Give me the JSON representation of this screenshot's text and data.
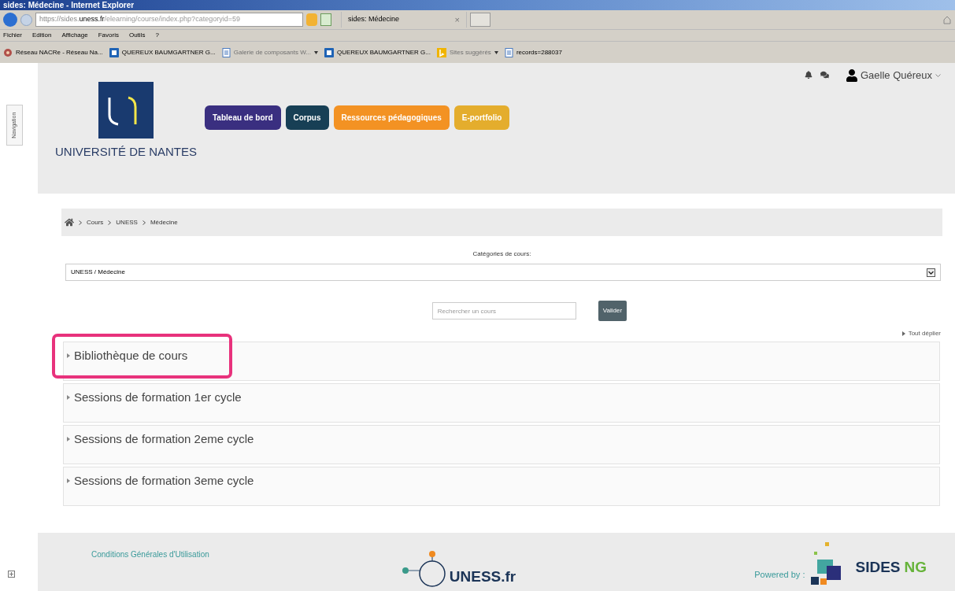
{
  "window": {
    "title": "sides: Médecine - Internet Explorer"
  },
  "address_bar": {
    "url_prefix": "https://sides.",
    "url_domain": "uness.fr",
    "url_path": "/elearning/course/index.php?categoryid=59",
    "tab_title": "sides: Médecine",
    "tab_close": "×"
  },
  "menu_bar": [
    "Fichier",
    "Edition",
    "Affichage",
    "Favoris",
    "Outils",
    "?"
  ],
  "favorites_bar": [
    {
      "label": "Réseau NACRe - Réseau Na...",
      "kind": "site",
      "faded": false,
      "dropdown": false
    },
    {
      "label": "QUEREUX BAUMGARTNER G...",
      "kind": "mail",
      "faded": false,
      "dropdown": false
    },
    {
      "label": "Galerie de composants W...",
      "kind": "page",
      "faded": true,
      "dropdown": true
    },
    {
      "label": "QUEREUX BAUMGARTNER G...",
      "kind": "mail",
      "faded": false,
      "dropdown": false
    },
    {
      "label": "Sites suggérés",
      "kind": "bing",
      "faded": true,
      "dropdown": true
    },
    {
      "label": "records=288037",
      "kind": "page",
      "faded": false,
      "dropdown": false
    }
  ],
  "side_tab": {
    "label": "Navigation"
  },
  "header": {
    "logo_text": "UNIVERSITÉ DE NANTES",
    "nav": [
      {
        "label": "Tableau de bord",
        "color": "#3a2f80"
      },
      {
        "label": "Corpus",
        "color": "#173f55"
      },
      {
        "label": "Ressources pédagogiques",
        "color": "#f39223"
      },
      {
        "label": "E-portfolio",
        "color": "#e4ad2d"
      }
    ],
    "user": "Gaelle Quéreux"
  },
  "breadcrumb": [
    "Cours",
    "UNESS",
    "Médecine"
  ],
  "category": {
    "label": "Catégories de cours:",
    "value": "UNESS / Médecine"
  },
  "search": {
    "placeholder": "Rechercher un cours",
    "button": "Valider"
  },
  "expand_all": "Tout déplier",
  "categories": [
    {
      "title": "Bibliothèque de cours",
      "expanded": false,
      "highlighted": true
    },
    {
      "title": "Sessions de formation 1er cycle",
      "expanded": false,
      "highlighted": false
    },
    {
      "title": "Sessions de formation 2eme cycle",
      "expanded": false,
      "highlighted": false
    },
    {
      "title": "Sessions de formation 3eme cycle",
      "expanded": false,
      "highlighted": false
    }
  ],
  "footer": {
    "terms": "Conditions Générales d'Utilisation",
    "uness": "UNESS.fr",
    "powered": "Powered by :",
    "sides": "SIDES",
    "sides_suffix": "NG"
  }
}
